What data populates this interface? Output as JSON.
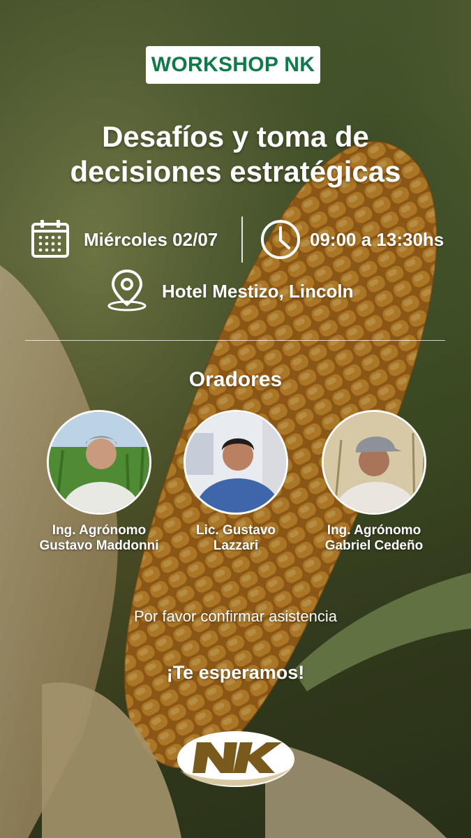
{
  "badge": "WORKSHOP NK",
  "title_line1": "Desafíos y toma de",
  "title_line2": "decisiones estratégicas",
  "date": "Miércoles 02/07",
  "time": "09:00 a 13:30hs",
  "location": "Hotel Mestizo, Lincoln",
  "speakers_heading": "Oradores",
  "speakers": [
    {
      "line1": "Ing. Agrónomo",
      "line2": "Gustavo Maddonni"
    },
    {
      "line1": "Lic. Gustavo",
      "line2": "Lazzari"
    },
    {
      "line1": "Ing. Agrónomo",
      "line2": "Gabriel Cedeño"
    }
  ],
  "confirm": "Por favor confirmar asistencia",
  "closing": "¡Te esperamos!",
  "logo_text": "NK",
  "colors": {
    "brand_green": "#0f7a4a",
    "white": "#ffffff"
  },
  "icons": [
    "calendar-icon",
    "clock-icon",
    "location-pin-icon"
  ]
}
